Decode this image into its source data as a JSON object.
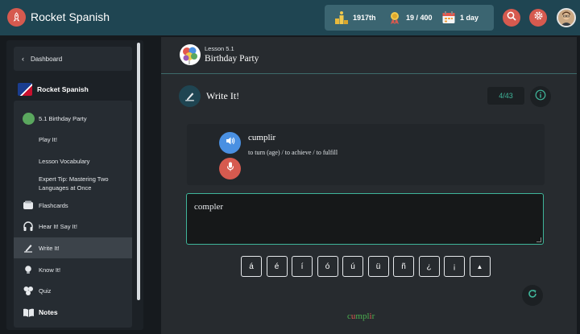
{
  "app": {
    "title": "Rocket Spanish"
  },
  "stats": {
    "rank": "1917th",
    "badges": "19 / 400",
    "streak": "1 day"
  },
  "sidebar": {
    "back_label": "Dashboard",
    "course_title": "Rocket Spanish",
    "items": [
      {
        "label": "5.1 Birthday Party",
        "icon": "green-dot-icon"
      },
      {
        "label": "Play It!",
        "icon": ""
      },
      {
        "label": "Lesson Vocabulary",
        "icon": ""
      },
      {
        "label": "Expert Tip: Mastering Two",
        "label2": "Languages at Once",
        "icon": ""
      },
      {
        "label": "Flashcards",
        "icon": "flashcards-icon"
      },
      {
        "label": "Hear It! Say It!",
        "icon": "headphones-icon"
      },
      {
        "label": "Write It!",
        "icon": "write-icon",
        "active": true
      },
      {
        "label": "Know It!",
        "icon": "lightbulb-icon"
      },
      {
        "label": "Quiz",
        "icon": "quiz-icon"
      },
      {
        "label": "Notes",
        "icon": "notes-icon"
      }
    ]
  },
  "lesson": {
    "subtitle": "Lesson 5.1",
    "title": "Birthday Party"
  },
  "activity": {
    "title": "Write It!",
    "counter": "4/43"
  },
  "card": {
    "word": "cumplir",
    "meaning": "to turn (age) / to achieve / to fulfill"
  },
  "answer": {
    "value": "compler"
  },
  "keys": [
    "á",
    "é",
    "í",
    "ó",
    "ú",
    "ü",
    "ñ",
    "¿",
    "¡",
    "▲"
  ],
  "result": {
    "p1": "c",
    "p2": "u",
    "p3": "mpl",
    "p4": "i",
    "p5": "r"
  },
  "colors": {
    "accent": "#3fb59a",
    "brand": "#d65a4f",
    "topbar": "#1f4552"
  }
}
